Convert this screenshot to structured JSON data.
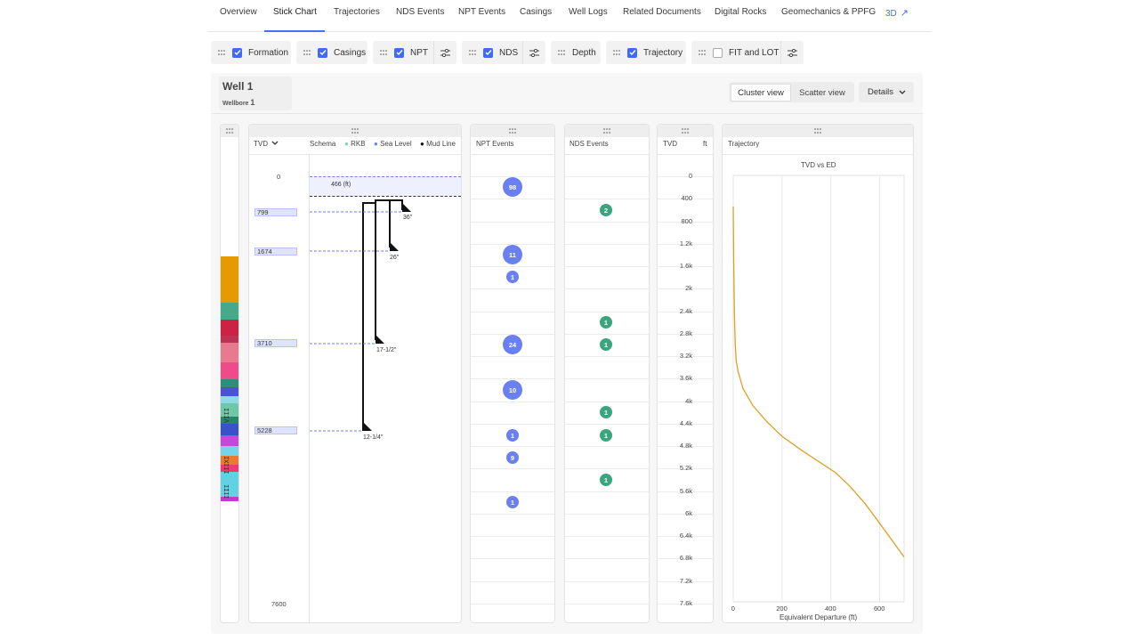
{
  "nav": {
    "tabs": [
      "Overview",
      "Stick Chart",
      "Trajectories",
      "NDS Events",
      "NPT Events",
      "Casings",
      "Well Logs",
      "Related Documents",
      "Digital Rocks",
      "Geomechanics & PPFG",
      "3D"
    ],
    "active": "Stick Chart"
  },
  "toolbar": {
    "formation": "Formation",
    "casings": "Casings",
    "npt": "NPT",
    "nds": "NDS",
    "depth": "Depth",
    "trajectory": "Trajectory",
    "fit_lot": "FIT and LOT"
  },
  "toolbar_state": {
    "formation": true,
    "casings": true,
    "npt": true,
    "nds": true,
    "trajectory": true,
    "fit_lot": false
  },
  "well": {
    "title": "Well 1",
    "wellbore_label": "Wellbore",
    "wellbore_value": "1"
  },
  "views": {
    "cluster": "Cluster view",
    "scatter": "Scatter view",
    "details": "Details"
  },
  "schema": {
    "tvd_label": "TVD",
    "schema_label": "Schema",
    "legend": [
      "RKB",
      "Sea Level",
      "Mud Line"
    ],
    "legend_colors": [
      "#7bd3b5",
      "#6b7ff0",
      "#111111"
    ],
    "top_depth": "0",
    "bottom_depth": "7600",
    "water_depth_label": "466 (ft)",
    "depth_tags": [
      "799",
      "1674",
      "3710",
      "5228"
    ],
    "casings": [
      "36\"",
      "26\"",
      "17-1/2\"",
      "12-1/4\""
    ]
  },
  "npt": {
    "title": "NPT Events",
    "events": [
      {
        "depth": 270,
        "count": "98"
      },
      {
        "depth": 1750,
        "count": "11"
      },
      {
        "depth": 2000,
        "count": "1"
      },
      {
        "depth": 3750,
        "count": "24"
      },
      {
        "depth": 4750,
        "count": "10"
      },
      {
        "depth": 6250,
        "count": "1"
      },
      {
        "depth": 7000,
        "count": "9"
      },
      {
        "depth": 8500,
        "count": "1"
      }
    ]
  },
  "nds": {
    "title": "NDS Events",
    "events": [
      {
        "depth": 520,
        "count": "2"
      },
      {
        "depth": 3000,
        "count": "1"
      },
      {
        "depth": 3750,
        "count": "1"
      },
      {
        "depth": 5750,
        "count": "1"
      },
      {
        "depth": 6250,
        "count": "1"
      },
      {
        "depth": 7250,
        "count": "1"
      }
    ]
  },
  "tvd_axis": {
    "title": "TVD",
    "unit": "ft",
    "ticks": [
      "0",
      "400",
      "800",
      "1.2k",
      "1.6k",
      "2k",
      "2.4k",
      "2.8k",
      "3.2k",
      "3.6k",
      "4k",
      "4.4k",
      "4.8k",
      "5.2k",
      "5.6k",
      "6k",
      "6.4k",
      "6.8k",
      "7.2k",
      "7.6k"
    ]
  },
  "trajectory": {
    "title": "Trajectory",
    "line_color": "#e0a020"
  },
  "chart_data": {
    "type": "line",
    "title": "TVD vs ED",
    "xlabel": "Equivalent Departure (ft)",
    "ylabel": "",
    "xlim": [
      0,
      700
    ],
    "ylim": [
      7600,
      0
    ],
    "x_ticks": [
      "0",
      "200",
      "400",
      "600"
    ],
    "series": [
      {
        "x": [
          0,
          2,
          5,
          8,
          12,
          20,
          40,
          80,
          140,
          200,
          280,
          350,
          420,
          480,
          540,
          600,
          650,
          700
        ],
        "y": [
          550,
          1500,
          2500,
          3000,
          3300,
          3500,
          3800,
          4100,
          4400,
          4650,
          4900,
          5100,
          5300,
          5550,
          5850,
          6200,
          6500,
          6800
        ]
      }
    ]
  },
  "formations": {
    "colors": [
      "#e59a00",
      "#45a98a",
      "#cc2244",
      "#bb3355",
      "#e87a90",
      "#ef4b8a",
      "#2f8c7a",
      "#4a52d8",
      "#8fd8e6",
      "#6fc7a8",
      "#2a8468",
      "#3a52c8",
      "#c24ad8",
      "#77d4e8",
      "#ea7b2e",
      "#ee3a70",
      "#62d2e2",
      "#c03ad0"
    ],
    "labels": [
      "VIII",
      "XI",
      "III",
      "II",
      "I",
      "II"
    ]
  }
}
